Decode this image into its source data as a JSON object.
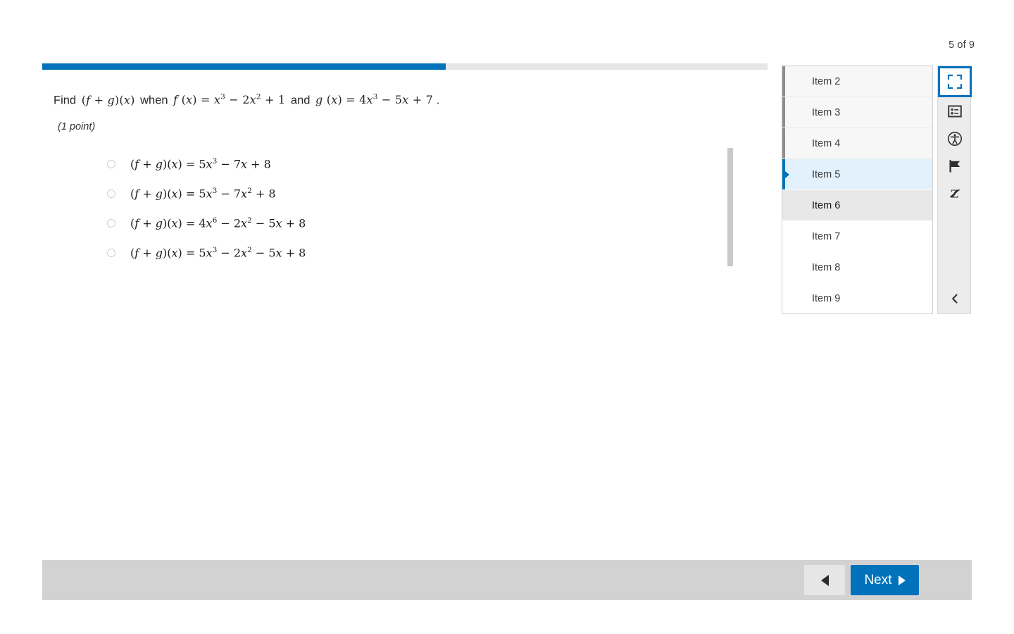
{
  "header": {
    "counter": "5 of 9"
  },
  "progress": {
    "percent": 55.6,
    "fill_color": "#0072bc",
    "track_color": "#e6e6e6"
  },
  "question": {
    "prompt_prefix": "Find",
    "prompt_mid": "when",
    "prompt_and": "and",
    "function_sum": "(f + g)(x)",
    "f_definition": "f(x) = x³ − 2x² + 1",
    "g_definition": "g(x) = 4x³ − 5x + 7",
    "points_label": "(1 point)",
    "options": [
      {
        "id": "a",
        "text": "(f + g)(x) = 5x³ − 7x + 8",
        "selected": false
      },
      {
        "id": "b",
        "text": "(f + g)(x) = 5x³ − 7x² + 8",
        "selected": false
      },
      {
        "id": "c",
        "text": "(f + g)(x) = 4x⁶ − 2x² − 5x + 8",
        "selected": false
      },
      {
        "id": "d",
        "text": "(f + g)(x) = 5x³ − 2x² − 5x + 8",
        "selected": false
      }
    ]
  },
  "item_nav": {
    "items": [
      {
        "label": "Item 2",
        "state": "visited"
      },
      {
        "label": "Item 3",
        "state": "visited"
      },
      {
        "label": "Item 4",
        "state": "visited"
      },
      {
        "label": "Item 5",
        "state": "selected"
      },
      {
        "label": "Item 6",
        "state": "hovered"
      },
      {
        "label": "Item 7",
        "state": "default"
      },
      {
        "label": "Item 8",
        "state": "default"
      },
      {
        "label": "Item 9",
        "state": "default"
      }
    ]
  },
  "tools": {
    "buttons": [
      {
        "icon": "fullscreen-icon",
        "active": true
      },
      {
        "icon": "item-list-icon",
        "active": false
      },
      {
        "icon": "accessibility-icon",
        "active": false
      },
      {
        "icon": "flag-icon",
        "active": false
      },
      {
        "icon": "strikethrough-icon",
        "active": false
      }
    ],
    "collapse_icon": "chevron-left-icon"
  },
  "footer": {
    "prev_icon": "triangle-left-icon",
    "next_label": "Next",
    "next_icon": "triangle-right-icon",
    "next_color": "#0072bc"
  }
}
